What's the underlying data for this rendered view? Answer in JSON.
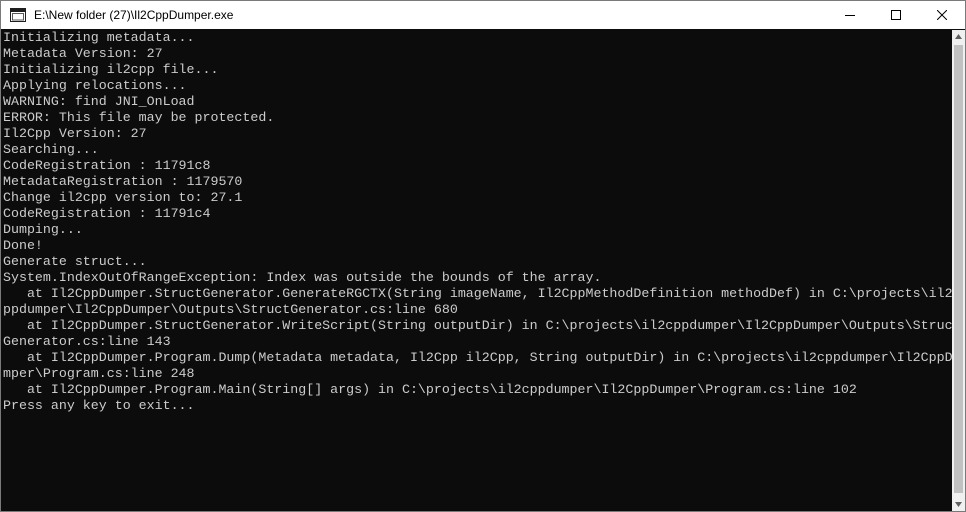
{
  "window": {
    "title": "E:\\New folder (27)\\Il2CppDumper.exe",
    "icon": "console-app-icon"
  },
  "caption_buttons": {
    "minimize": "minimize-icon",
    "maximize": "maximize-icon",
    "close": "close-icon"
  },
  "console": {
    "text_color": "#cccccc",
    "background_color": "#0c0c0c",
    "lines": [
      "Initializing metadata...",
      "Metadata Version: 27",
      "Initializing il2cpp file...",
      "Applying relocations...",
      "WARNING: find JNI_OnLoad",
      "ERROR: This file may be protected.",
      "Il2Cpp Version: 27",
      "Searching...",
      "CodeRegistration : 11791c8",
      "MetadataRegistration : 1179570",
      "Change il2cpp version to: 27.1",
      "CodeRegistration : 11791c4",
      "Dumping...",
      "Done!",
      "Generate struct...",
      "System.IndexOutOfRangeException: Index was outside the bounds of the array.",
      "   at Il2CppDumper.StructGenerator.GenerateRGCTX(String imageName, Il2CppMethodDefinition methodDef) in C:\\projects\\il2c",
      "ppdumper\\Il2CppDumper\\Outputs\\StructGenerator.cs:line 680",
      "   at Il2CppDumper.StructGenerator.WriteScript(String outputDir) in C:\\projects\\il2cppdumper\\Il2CppDumper\\Outputs\\Struct",
      "Generator.cs:line 143",
      "   at Il2CppDumper.Program.Dump(Metadata metadata, Il2Cpp il2Cpp, String outputDir) in C:\\projects\\il2cppdumper\\Il2CppDu",
      "mper\\Program.cs:line 248",
      "   at Il2CppDumper.Program.Main(String[] args) in C:\\projects\\il2cppdumper\\Il2CppDumper\\Program.cs:line 102",
      "Press any key to exit..."
    ]
  }
}
